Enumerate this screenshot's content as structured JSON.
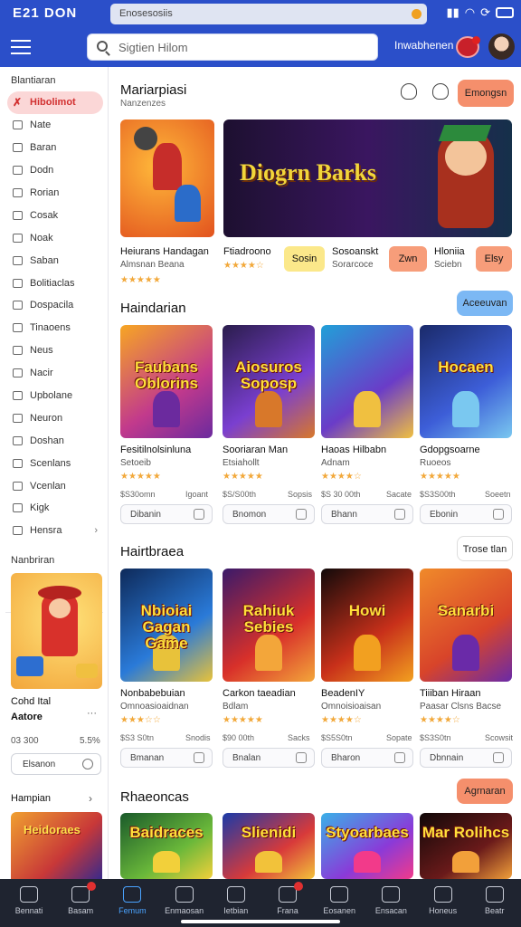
{
  "status": {
    "time": "E21 DON",
    "url": "Enosesosiis"
  },
  "topbar": {
    "search_placeholder": "Sigtien Hilom",
    "link": "Inwabhenen"
  },
  "sidebar": {
    "heading": "Blantiaran",
    "items": [
      {
        "label": "Hibolimot",
        "active": true
      },
      {
        "label": "Nate"
      },
      {
        "label": "Baran"
      },
      {
        "label": "Dodn"
      },
      {
        "label": "Rorian"
      },
      {
        "label": "Cosak"
      },
      {
        "label": "Noak"
      },
      {
        "label": "Saban"
      },
      {
        "label": "Bolitiaclas"
      },
      {
        "label": "Dospacila"
      },
      {
        "label": "Tinaoens"
      },
      {
        "label": "Neus"
      },
      {
        "label": "Nacir"
      },
      {
        "label": "Upbolane"
      },
      {
        "label": "Neuron"
      },
      {
        "label": "Doshan"
      },
      {
        "label": "Scenlans"
      },
      {
        "label": "Vcenlan"
      },
      {
        "label": "Kigk"
      },
      {
        "label": "Hensra"
      }
    ],
    "promo": {
      "heading": "Nanbriran",
      "title": "Cohd Ital",
      "subtitle": "Aatore",
      "dots": "···",
      "price": "03 300",
      "percent": "5.5%",
      "button": "Elsanon"
    },
    "more": {
      "label": "Hampian"
    },
    "thumb": {
      "label": "Heidoraes"
    }
  },
  "featured": {
    "title": "Mariarpiasi",
    "subtitle": "Nanzenzes",
    "button": "Emongsn",
    "cards": [
      {
        "title": "Heiurans Handagan",
        "subtitle": "Almsnan Beana",
        "stars": "★★★★★"
      },
      {
        "title": "Ftiadroono",
        "stars": "★★★★☆",
        "button": "Sosin"
      },
      {
        "title": "Sosoanskt",
        "subtitle": "Sorarcoce",
        "button": "Zwn"
      },
      {
        "title": "Hloniia",
        "subtitle": "Sciebn",
        "button": "Elsy"
      }
    ],
    "banner": "Diogrn Barks"
  },
  "section2": {
    "title": "Haindarian",
    "button": "Aceeuvan",
    "cards": [
      {
        "art": "Faubans Oblorins",
        "title": "Fesitilnolsinluna",
        "subtitle": "Setoeib",
        "stars": "★★★★★",
        "price": "$S30omn",
        "perc": "Igoant",
        "button": "Dibanin"
      },
      {
        "art": "Aiosuros Soposp",
        "title": "Sooriaran Man",
        "subtitle": "Etsiahollt",
        "stars": "★★★★★",
        "price": "$S/S00th",
        "perc": "Sopsis",
        "button": "Bnomon"
      },
      {
        "art": "",
        "title": "Haoas Hilbabn",
        "subtitle": "Adnam",
        "stars": "★★★★☆",
        "price": "$S 30 00th",
        "perc": "Sacate",
        "button": "Bhann"
      },
      {
        "art": "Hocaen",
        "title": "Gdopgsoarne",
        "subtitle": "Ruoeos",
        "stars": "★★★★★",
        "price": "$S3S00th",
        "perc": "Soeetn",
        "button": "Ebonin"
      }
    ]
  },
  "section3": {
    "title": "Hairtbraea",
    "button": "Trose tlan",
    "cards": [
      {
        "art": "Nbioiai Gagan Game",
        "title": "Nonbabebuian",
        "subtitle": "Omnoasioaidnan",
        "stars": "★★★☆☆",
        "price": "$S3 S0tn",
        "perc": "Snodis",
        "button": "Bmanan"
      },
      {
        "art": "Rahiuk Sebies",
        "title": "Carkon taeadian",
        "subtitle": "Bdlam",
        "stars": "★★★★★",
        "price": "$90 00th",
        "perc": "Sacks",
        "button": "Bnalan"
      },
      {
        "art": "Howi",
        "title": "BeadenIY",
        "subtitle": "Omnoisioaisan",
        "stars": "★★★★☆",
        "price": "$S5S0tn",
        "perc": "Sopate",
        "button": "Bharon"
      },
      {
        "art": "Sanarbi",
        "title": "Tiiiban Hiraan",
        "subtitle": "Paasar Clsns Bacse",
        "stars": "★★★★☆",
        "price": "$S3S0tn",
        "perc": "Scowsit",
        "button": "Dbnnain"
      }
    ]
  },
  "section4": {
    "title": "Rhaeoncas",
    "button": "Agrnaran",
    "cards": [
      {
        "art": "Baidraces"
      },
      {
        "art": "Slienidi"
      },
      {
        "art": "Styoarbaes"
      },
      {
        "art": "Mar Rolihcs"
      }
    ]
  },
  "nav": [
    {
      "label": "Bennati"
    },
    {
      "label": "Basam"
    },
    {
      "label": "Femum",
      "active": true
    },
    {
      "label": "Enmaosan"
    },
    {
      "label": "Ietbian"
    },
    {
      "label": "Frana"
    },
    {
      "label": "Eosanen"
    },
    {
      "label": "Ensacan"
    },
    {
      "label": "Honeus"
    },
    {
      "label": "Beatr"
    }
  ]
}
